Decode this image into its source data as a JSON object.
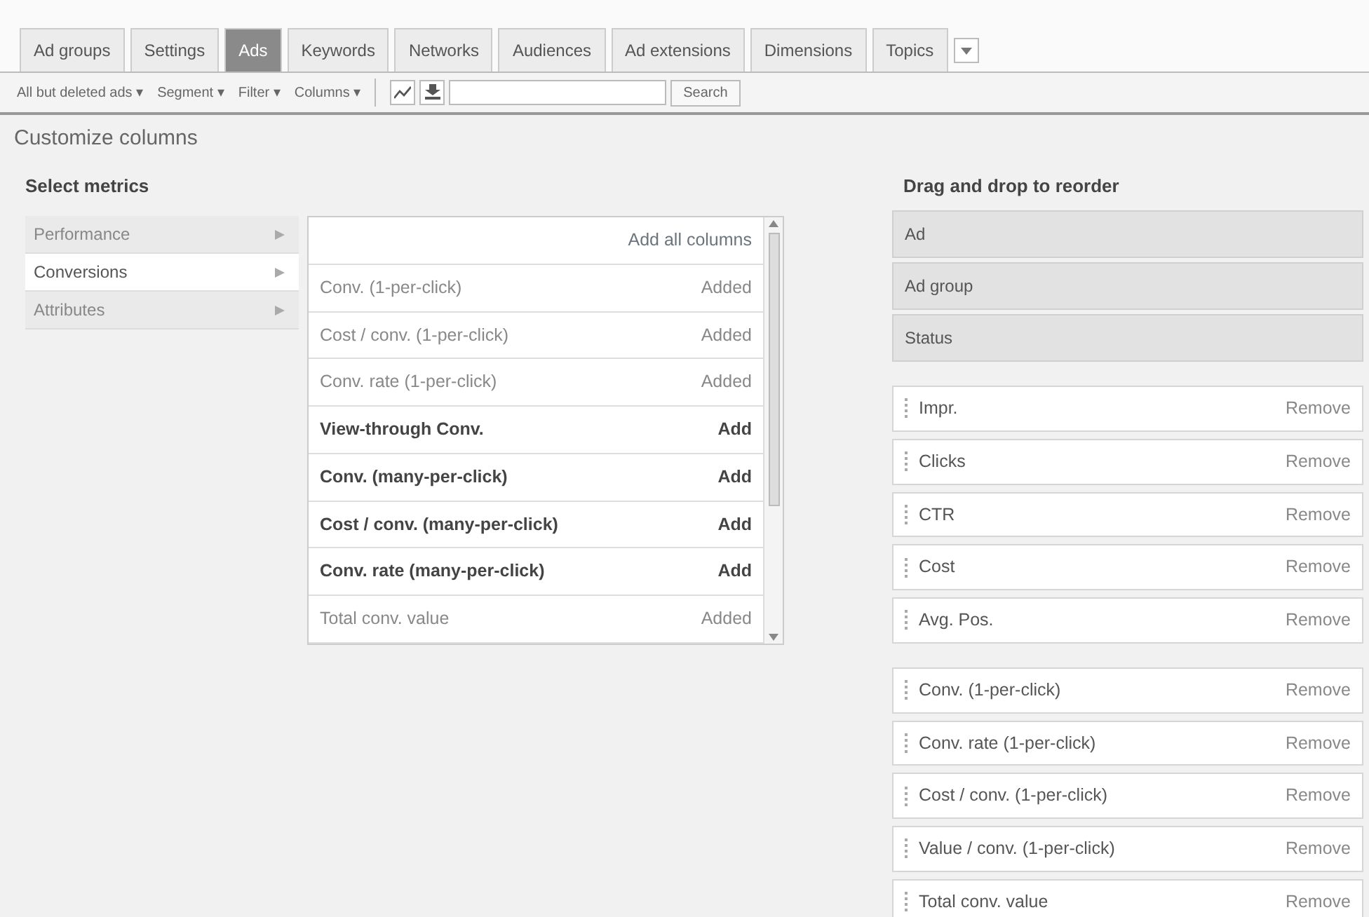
{
  "tabs": [
    {
      "label": "Ad groups",
      "selected": false
    },
    {
      "label": "Settings",
      "selected": false
    },
    {
      "label": "Ads",
      "selected": true
    },
    {
      "label": "Keywords",
      "selected": false
    },
    {
      "label": "Networks",
      "selected": false
    },
    {
      "label": "Audiences",
      "selected": false
    },
    {
      "label": "Ad extensions",
      "selected": false
    },
    {
      "label": "Dimensions",
      "selected": false
    },
    {
      "label": "Topics",
      "selected": false
    }
  ],
  "toolbar": {
    "menus": [
      "All but deleted ads ▾",
      "Segment ▾",
      "Filter ▾",
      "Columns ▾"
    ],
    "search_button": "Search"
  },
  "title": "Customize columns",
  "select_metrics": {
    "heading": "Select metrics",
    "categories": [
      {
        "label": "Performance",
        "selected": false
      },
      {
        "label": "Conversions",
        "selected": true
      },
      {
        "label": "Attributes",
        "selected": false
      }
    ],
    "add_all": "Add all columns",
    "metrics": [
      {
        "label": "Conv. (1-per-click)",
        "action": "Added",
        "added": true
      },
      {
        "label": "Cost / conv. (1-per-click)",
        "action": "Added",
        "added": true
      },
      {
        "label": "Conv. rate (1-per-click)",
        "action": "Added",
        "added": true
      },
      {
        "label": "View-through Conv.",
        "action": "Add",
        "added": false
      },
      {
        "label": "Conv. (many-per-click)",
        "action": "Add",
        "added": false
      },
      {
        "label": "Cost / conv. (many-per-click)",
        "action": "Add",
        "added": false
      },
      {
        "label": "Conv. rate (many-per-click)",
        "action": "Add",
        "added": false
      },
      {
        "label": "Total conv. value",
        "action": "Added",
        "added": true
      }
    ]
  },
  "reorder": {
    "heading": "Drag and drop to reorder",
    "locked_columns": [
      "Ad",
      "Ad group",
      "Status"
    ],
    "groups": [
      [
        {
          "label": "Impr.",
          "action": "Remove"
        },
        {
          "label": "Clicks",
          "action": "Remove"
        },
        {
          "label": "CTR",
          "action": "Remove"
        },
        {
          "label": "Cost",
          "action": "Remove"
        },
        {
          "label": "Avg. Pos.",
          "action": "Remove"
        }
      ],
      [
        {
          "label": "Conv. (1-per-click)",
          "action": "Remove"
        },
        {
          "label": "Conv. rate (1-per-click)",
          "action": "Remove"
        },
        {
          "label": "Cost / conv. (1-per-click)",
          "action": "Remove"
        },
        {
          "label": "Value / conv. (1-per-click)",
          "action": "Remove"
        },
        {
          "label": "Total conv. value",
          "action": "Remove"
        }
      ]
    ]
  }
}
